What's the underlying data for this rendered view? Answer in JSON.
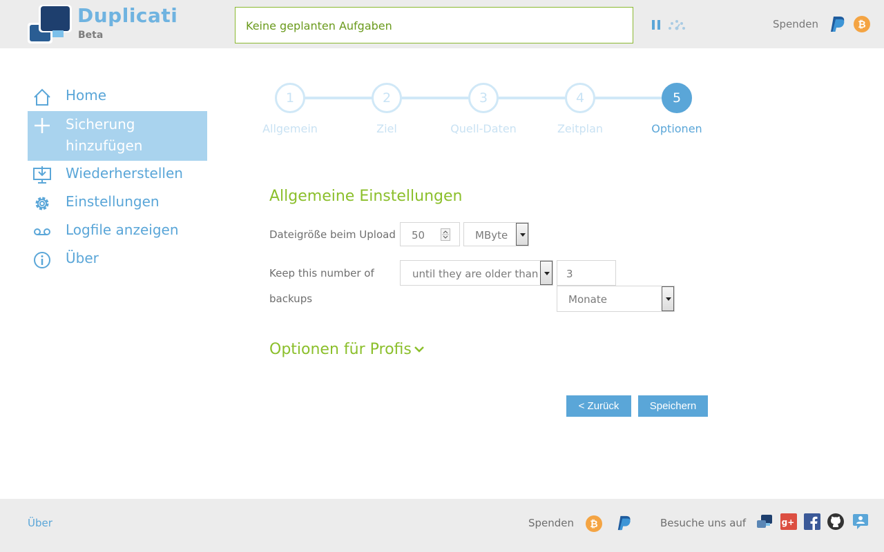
{
  "header": {
    "brand_title": "Duplicati",
    "brand_subtitle": "Beta",
    "status_text": "Keine geplanten Aufgaben",
    "donate_label": "Spenden",
    "icons": [
      "pause-icon",
      "throttle-icon",
      "paypal-icon",
      "bitcoin-icon"
    ]
  },
  "sidebar": {
    "items": [
      {
        "label": "Home",
        "icon": "home-icon"
      },
      {
        "label": "Sicherung hinzufügen",
        "icon": "plus-icon",
        "active": true
      },
      {
        "label": "Wiederherstellen",
        "icon": "restore-icon"
      },
      {
        "label": "Einstellungen",
        "icon": "gear-icon"
      },
      {
        "label": "Logfile anzeigen",
        "icon": "log-icon"
      },
      {
        "label": "Über",
        "icon": "info-icon"
      }
    ]
  },
  "wizard": {
    "steps": [
      {
        "number": "1",
        "label": "Allgemein"
      },
      {
        "number": "2",
        "label": "Ziel"
      },
      {
        "number": "3",
        "label": "Quell-Daten"
      },
      {
        "number": "4",
        "label": "Zeitplan"
      },
      {
        "number": "5",
        "label": "Optionen",
        "active": true
      }
    ]
  },
  "form": {
    "section_title": "Allgemeine Einstellungen",
    "upload_size_label": "Dateigröße beim Upload",
    "upload_size_value": "50",
    "upload_size_unit": "MByte",
    "keep_label_line1": "Keep this number of",
    "keep_label_line2": "backups",
    "keep_mode_value": "until they are older than",
    "keep_amount_value": "3",
    "keep_unit_value": "Monate",
    "pro_options_label": "Optionen für Profis",
    "back_button": "< Zurück",
    "save_button": "Speichern"
  },
  "footer": {
    "about_link": "Über",
    "donate_label": "Spenden",
    "visit_label": "Besuche uns auf",
    "social_icons": [
      "duplicati-forum-icon",
      "google-plus-icon",
      "facebook-icon",
      "github-icon",
      "chat-icon"
    ]
  },
  "colors": {
    "accent_blue": "#5aa6d8",
    "active_nav_bg": "#a9d3ee",
    "green": "#8bbf2b",
    "header_bg": "#ececec"
  }
}
